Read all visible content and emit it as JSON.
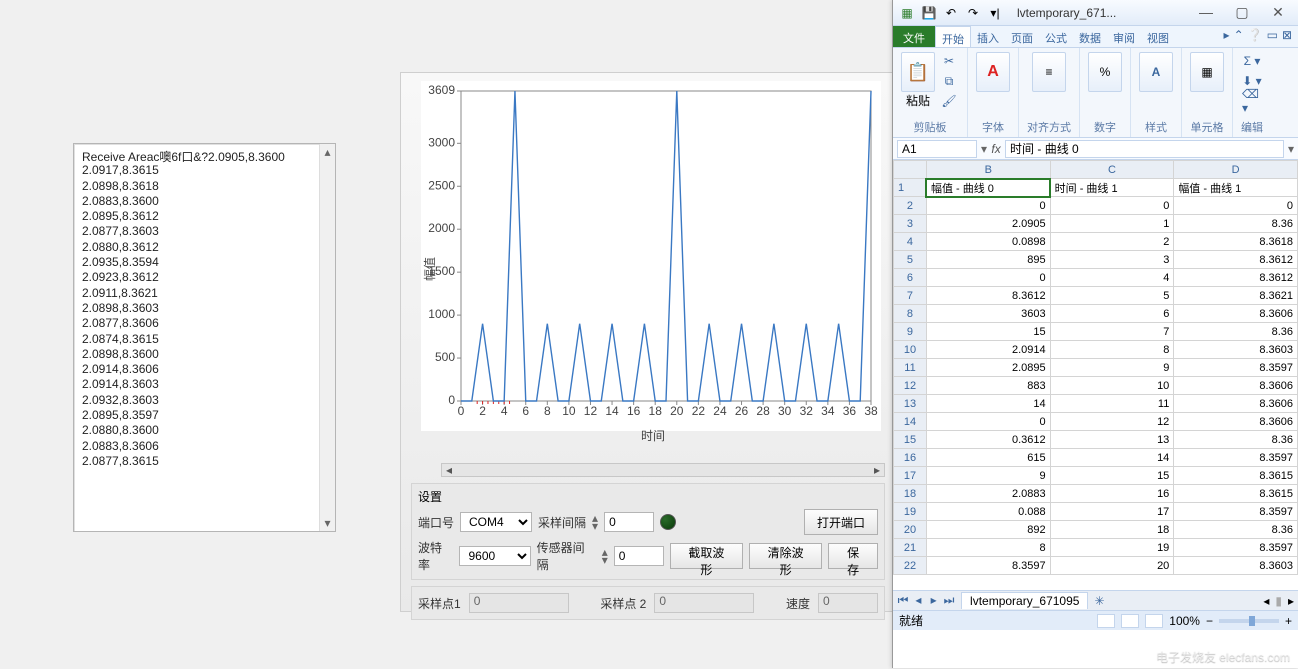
{
  "receive": {
    "header": "Receive Areac噢6f口&?2.0905,8.3600",
    "lines": [
      "2.0917,8.3615",
      "2.0898,8.3618",
      "2.0883,8.3600",
      "2.0895,8.3612",
      "2.0877,8.3603",
      "2.0880,8.3612",
      "2.0935,8.3594",
      "2.0923,8.3612",
      "2.0911,8.3621",
      "2.0898,8.3603",
      "2.0877,8.3606",
      "2.0874,8.3615",
      "2.0898,8.3600",
      "2.0914,8.3606",
      "2.0914,8.3603",
      "2.0932,8.3603",
      "2.0895,8.3597",
      "2.0880,8.3600",
      "2.0883,8.3606",
      "2.0877,8.3615"
    ]
  },
  "chart_data": {
    "type": "line",
    "xlabel": "时间",
    "ylabel": "幅值",
    "xlim": [
      0,
      38
    ],
    "ylim": [
      0,
      3609
    ],
    "xticks": [
      0,
      2,
      4,
      6,
      8,
      10,
      12,
      14,
      16,
      18,
      20,
      22,
      24,
      26,
      28,
      30,
      32,
      34,
      36,
      38
    ],
    "yticks": [
      0,
      500,
      1000,
      1500,
      2000,
      2500,
      3000,
      3609
    ],
    "series": [
      {
        "name": "曲线 0",
        "values": [
          0,
          0,
          900,
          0,
          0,
          3609,
          0,
          0,
          900,
          0,
          0,
          900,
          0,
          0,
          900,
          0,
          0,
          900,
          0,
          0,
          3609,
          0,
          0,
          900,
          0,
          0,
          900,
          0,
          0,
          900,
          0,
          0,
          900,
          0,
          0,
          900,
          0,
          0,
          3609
        ]
      }
    ]
  },
  "settings": {
    "title": "设置",
    "port_label": "端口号",
    "port_value": "COM4",
    "baud_label": "波特率",
    "baud_value": "9600",
    "sample_interval_label": "采样间隔",
    "sample_interval_value": "0",
    "sensor_interval_label": "传感器间隔",
    "sensor_interval_value": "0",
    "open_port": "打开端口",
    "capture_wave": "截取波形",
    "clear_wave": "清除波形",
    "save": "保存"
  },
  "sample": {
    "pt1_label": "采样点1",
    "pt1_value": "0",
    "pt2_label": "采样点 2",
    "pt2_value": "0",
    "speed_label": "速度",
    "speed_value": "0"
  },
  "excel": {
    "title": "lvtemporary_671...",
    "tabs": [
      "文件",
      "开始",
      "插入",
      "页面",
      "公式",
      "数据",
      "审阅",
      "视图"
    ],
    "active_tab": 1,
    "ribbon_groups": {
      "clipboard": {
        "label": "剪贴板",
        "paste": "粘贴"
      },
      "font": {
        "label": "字体"
      },
      "align": {
        "label": "对齐方式"
      },
      "number": {
        "label": "数字"
      },
      "style": {
        "label": "样式"
      },
      "cell": {
        "label": "单元格"
      },
      "edit": {
        "label": "编辑"
      }
    },
    "name_box": "A1",
    "formula": "时间 - 曲线 0",
    "columns": [
      "",
      "B",
      "C",
      "D"
    ],
    "col_widths": [
      "24px",
      "120px",
      "120px",
      "120px"
    ],
    "header_row": [
      "",
      "幅值 - 曲线 0",
      "时间 - 曲线 1",
      "幅值 - 曲线 1"
    ],
    "rows": [
      {
        "n": 2,
        "B": "0",
        "C": "0",
        "D": "0"
      },
      {
        "n": 3,
        "B": "2.0905",
        "C": "1",
        "D": "8.36"
      },
      {
        "n": 4,
        "B": "0.0898",
        "C": "2",
        "D": "8.3618"
      },
      {
        "n": 5,
        "B": "895",
        "C": "3",
        "D": "8.3612"
      },
      {
        "n": 6,
        "B": "0",
        "C": "4",
        "D": "8.3612"
      },
      {
        "n": 7,
        "B": "8.3612",
        "C": "5",
        "D": "8.3621"
      },
      {
        "n": 8,
        "B": "3603",
        "C": "6",
        "D": "8.3606"
      },
      {
        "n": 9,
        "B": "15",
        "C": "7",
        "D": "8.36"
      },
      {
        "n": 10,
        "B": "2.0914",
        "C": "8",
        "D": "8.3603"
      },
      {
        "n": 11,
        "B": "2.0895",
        "C": "9",
        "D": "8.3597"
      },
      {
        "n": 12,
        "B": "883",
        "C": "10",
        "D": "8.3606"
      },
      {
        "n": 13,
        "B": "14",
        "C": "11",
        "D": "8.3606"
      },
      {
        "n": 14,
        "B": "0",
        "C": "12",
        "D": "8.3606"
      },
      {
        "n": 15,
        "B": "0.3612",
        "C": "13",
        "D": "8.36"
      },
      {
        "n": 16,
        "B": "615",
        "C": "14",
        "D": "8.3597"
      },
      {
        "n": 17,
        "B": "9",
        "C": "15",
        "D": "8.3615"
      },
      {
        "n": 18,
        "B": "2.0883",
        "C": "16",
        "D": "8.3615"
      },
      {
        "n": 19,
        "B": "0.088",
        "C": "17",
        "D": "8.3597"
      },
      {
        "n": 20,
        "B": "892",
        "C": "18",
        "D": "8.36"
      },
      {
        "n": 21,
        "B": "8",
        "C": "19",
        "D": "8.3597"
      },
      {
        "n": 22,
        "B": "8.3597",
        "C": "20",
        "D": "8.3603"
      }
    ],
    "sheet_tab": "lvtemporary_671095",
    "status_ready": "就绪",
    "zoom": "100%"
  },
  "watermark": "电子发烧友 elecfans.com"
}
